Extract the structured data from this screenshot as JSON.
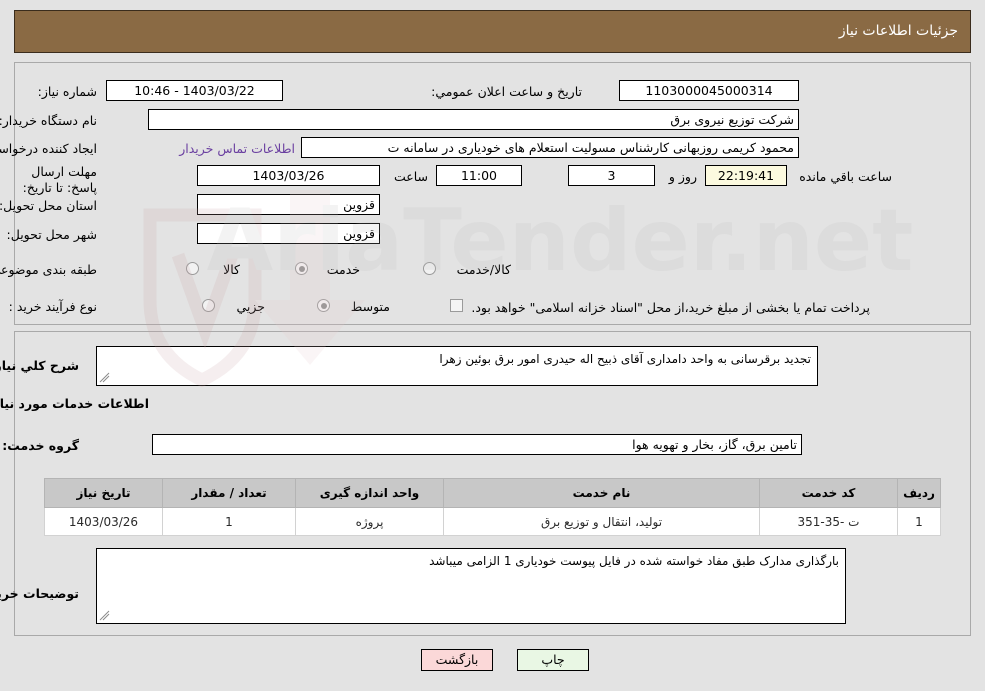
{
  "header": {
    "title": "جزئیات اطلاعات نیاز"
  },
  "top_section": {
    "need_number_label": "شماره نیاز:",
    "need_number_value": "1103000045000314",
    "public_announce_label": "تاریخ و ساعت اعلان عمومي:",
    "public_announce_value": "1403/03/22 - 10:46",
    "buyer_org_label": "نام دستگاه خریدار:",
    "buyer_org_value": "شرکت توزیع نیروی برق",
    "blank_field_value": "",
    "creator_label": "ایجاد کننده درخواست:",
    "creator_value": "محمود کریمی روزبهانی کارشناس  مسولیت استعلام های خودیاری در سامانه ت",
    "contact_link": "اطلاعات تماس خریدار",
    "deadline_label": "مهلت ارسال پاسخ: تا تاریخ:",
    "deadline_date": "1403/03/26",
    "hour_label": "ساعت",
    "deadline_time": "11:00",
    "days_value": "3",
    "days_suffix": "روز و",
    "countdown_value": "22:19:41",
    "countdown_suffix": "ساعت باقي مانده",
    "province_label": "استان محل تحویل:",
    "province_value": "قزوین",
    "city_label": "شهر محل تحویل:",
    "city_value": "قزوین",
    "category_label": "طبقه بندی موضوعی:",
    "category_options": [
      {
        "label": "کالا",
        "selected": false
      },
      {
        "label": "خدمت",
        "selected": true
      },
      {
        "label": "کالا/خدمت",
        "selected": false
      }
    ],
    "process_label": "نوع فرآیند خرید :",
    "process_options": [
      {
        "label": "جزیي",
        "selected": false
      },
      {
        "label": "متوسط",
        "selected": true
      }
    ],
    "treasury_checkbox_label": "پرداخت تمام یا بخشی از مبلغ خرید،از محل \"اسناد خزانه اسلامی\" خواهد بود.",
    "treasury_checked": false
  },
  "mid_section": {
    "general_desc_label": "شرح کلي نیاز:",
    "general_desc_value": "تجدید برقرسانی به واحد دامداری آقای ذبیح اله حیدری امور برق بوئین زهرا",
    "services_info_title": "اطلاعات خدمات مورد نیاز",
    "service_group_label": "گروه خدمت:",
    "service_group_value": "تامین برق، گاز، بخار و تهویه هوا",
    "table": {
      "columns": [
        "ردیف",
        "کد خدمت",
        "نام خدمت",
        "واحد اندازه گیری",
        "تعداد / مقدار",
        "تاریخ نیاز"
      ],
      "rows": [
        [
          "1",
          "ت -35-351",
          "تولید، انتقال و توزیع برق",
          "پروژه",
          "1",
          "1403/03/26"
        ]
      ]
    },
    "buyer_notes_label": "توضیحات خریدار:",
    "buyer_notes_value": "بارگذاری مدارک طبق مفاد خواسته شده در فایل پیوست خودیاری 1 الزامی میباشد"
  },
  "footer": {
    "back_button": "بازگشت",
    "print_button": "چاپ"
  },
  "watermark": {
    "text": "AriaTender.net"
  },
  "colors": {
    "header_bg": "#8a6a44",
    "page_bg": "#e3e3e3",
    "link": "#6a3fa0",
    "back_btn": "#fbd8d8",
    "print_btn": "#e9f7e4",
    "countdown_bg": "#fcfadf"
  }
}
